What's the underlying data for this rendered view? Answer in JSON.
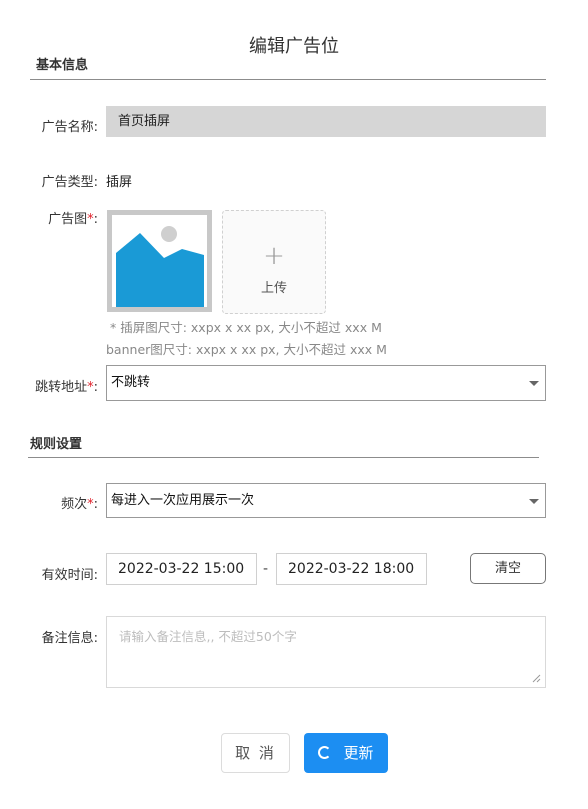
{
  "dialog": {
    "title": "编辑广告位"
  },
  "basic_section": {
    "title": "基本信息"
  },
  "ad_name": {
    "label": "广告名称:",
    "value": "首页插屏"
  },
  "ad_type": {
    "label": "广告类型:",
    "value": "插屏"
  },
  "ad_image": {
    "label": "广告图",
    "required_mark": "*",
    "colon": ":",
    "thumbnail_icon": "image-placeholder-icon",
    "upload_icon": "plus-icon",
    "upload_label": "上传",
    "hint_line1": "* 插屏图尺寸:  xxpx x xx px,  大小不超过 xxx M",
    "hint_line2": "banner图尺寸:  xxpx x xx px,  大小不超过 xxx M"
  },
  "redirect": {
    "label": "跳转地址",
    "required_mark": "*",
    "colon": ":",
    "selected": "不跳转"
  },
  "rules_section": {
    "title": "规则设置"
  },
  "frequency": {
    "label": "频次",
    "required_mark": "*",
    "colon": ":",
    "selected": "每进入一次应用展示一次"
  },
  "valid_time": {
    "label": "有效时间:",
    "start": "2022-03-22 15:00",
    "separator": "-",
    "end": "2022-03-22 18:00",
    "clear_label": "清空"
  },
  "remark": {
    "label": "备注信息:",
    "value": "",
    "placeholder": "请输入备注信息,, 不超过50个字"
  },
  "footer": {
    "cancel_label": "取 消",
    "submit_label": "更新"
  },
  "colors": {
    "primary": "#1c8ef2",
    "required": "#e0202a",
    "image_blue": "#1a9ad6",
    "readonly_bg": "#d6d6d6"
  }
}
